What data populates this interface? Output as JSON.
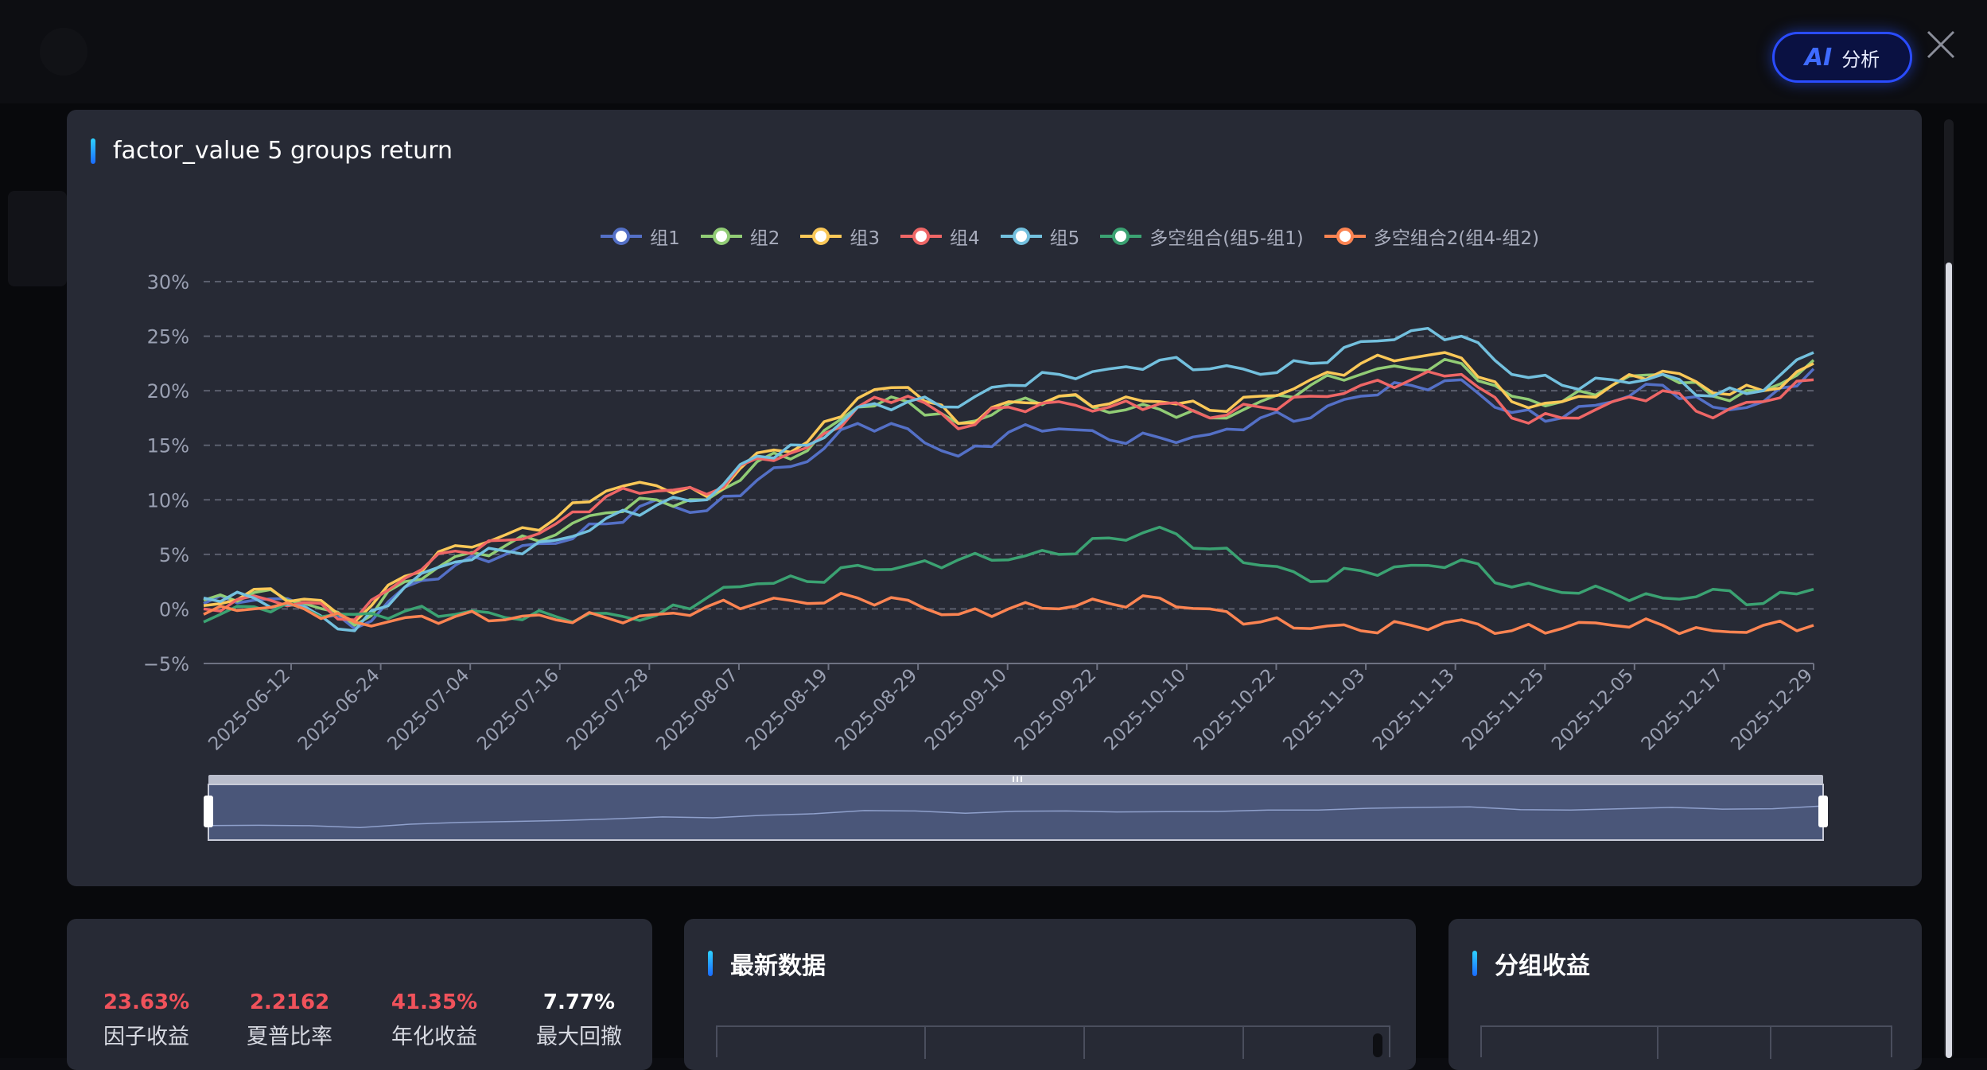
{
  "ai_button": {
    "label": "分析",
    "mark": "AI"
  },
  "main_panel": {
    "title": "factor_value 5 groups return"
  },
  "chart_data": {
    "type": "line",
    "title": "factor_value 5 groups return",
    "xlabel": "",
    "ylabel": "",
    "ylim": [
      -5,
      30
    ],
    "y_unit": "%",
    "y_ticks": [
      "30%",
      "25%",
      "20%",
      "15%",
      "10%",
      "5%",
      "0%",
      "−5%"
    ],
    "x_tick_labels": [
      "2025-06-12",
      "2025-06-24",
      "2025-07-04",
      "2025-07-16",
      "2025-07-28",
      "2025-08-07",
      "2025-08-19",
      "2025-08-29",
      "2025-09-10",
      "2025-09-22",
      "2025-10-10",
      "2025-10-22",
      "2025-11-03",
      "2025-11-13",
      "2025-11-25",
      "2025-12-05",
      "2025-12-17",
      "2025-12-29"
    ],
    "grid": "horizontal-dashed",
    "legend_position": "top-center",
    "x_points": [
      0,
      6,
      12,
      18,
      24,
      30,
      36,
      42,
      48,
      54,
      60,
      66,
      72,
      78,
      84,
      90,
      96,
      102,
      108,
      114,
      120,
      126,
      132,
      138,
      144,
      150,
      156,
      162,
      168,
      174,
      180,
      186,
      192
    ],
    "series": [
      {
        "name": "组1",
        "color": "#5470c6",
        "values": [
          0.5,
          0.8,
          0.3,
          -1.8,
          2.0,
          4.0,
          5.0,
          6.0,
          7.8,
          10.0,
          9.0,
          11.8,
          13.5,
          17.0,
          16.5,
          14.0,
          16.2,
          16.5,
          15.5,
          15.7,
          16.0,
          17.5,
          17.5,
          19.5,
          20.5,
          21.0,
          18.0,
          17.5,
          19.0,
          20.5,
          18.5,
          19.0,
          22.0
        ]
      },
      {
        "name": "组2",
        "color": "#91cc75",
        "values": [
          0.8,
          1.5,
          0.5,
          -1.5,
          2.5,
          4.8,
          5.8,
          6.8,
          8.8,
          10.0,
          10.0,
          13.5,
          14.5,
          18.5,
          19.0,
          17.0,
          18.8,
          19.5,
          18.0,
          18.3,
          17.5,
          19.0,
          20.5,
          21.5,
          22.0,
          22.5,
          19.5,
          19.0,
          20.5,
          21.5,
          19.5,
          20.0,
          22.8
        ]
      },
      {
        "name": "组3",
        "color": "#fac858",
        "values": [
          0.3,
          1.8,
          0.9,
          -1.2,
          3.0,
          5.8,
          6.8,
          8.3,
          10.8,
          11.3,
          10.3,
          14.3,
          15.3,
          19.3,
          20.3,
          17.0,
          19.0,
          19.5,
          18.8,
          19.0,
          18.2,
          19.5,
          21.0,
          22.5,
          23.0,
          23.0,
          19.0,
          19.0,
          20.5,
          21.8,
          19.8,
          20.0,
          22.5
        ]
      },
      {
        "name": "组4",
        "color": "#ee6666",
        "values": [
          0.0,
          1.2,
          0.6,
          -1.0,
          2.8,
          5.3,
          6.3,
          7.8,
          10.3,
          10.8,
          10.5,
          13.8,
          14.8,
          18.5,
          19.5,
          16.5,
          18.5,
          19.0,
          18.5,
          18.8,
          17.5,
          18.5,
          19.5,
          20.5,
          21.0,
          21.5,
          17.5,
          17.5,
          19.0,
          20.0,
          17.5,
          19.0,
          21.0
        ]
      },
      {
        "name": "组5",
        "color": "#73c0de",
        "values": [
          1.0,
          1.0,
          0.2,
          -2.0,
          2.0,
          4.3,
          5.3,
          6.3,
          8.3,
          9.5,
          10.0,
          14.0,
          15.0,
          18.5,
          19.0,
          18.5,
          20.5,
          21.5,
          22.0,
          22.8,
          22.0,
          21.5,
          22.5,
          24.5,
          25.5,
          25.0,
          21.5,
          20.5,
          21.0,
          21.5,
          19.5,
          20.0,
          23.5
        ]
      },
      {
        "name": "多空组合(组5-组1)",
        "color": "#3ba272",
        "values": [
          -1.2,
          0.2,
          0.0,
          -0.5,
          -0.2,
          -0.5,
          -0.8,
          -0.7,
          -0.4,
          -0.6,
          1.0,
          2.3,
          2.5,
          4.0,
          4.0,
          4.5,
          4.5,
          5.0,
          6.5,
          7.5,
          5.5,
          4.0,
          2.5,
          3.5,
          4.0,
          4.5,
          2.0,
          1.5,
          1.5,
          1.0,
          1.8,
          0.5,
          1.8
        ]
      },
      {
        "name": "多空组合2(组4-组2)",
        "color": "#fc8452",
        "values": [
          -0.5,
          0.0,
          0.0,
          -1.2,
          -0.8,
          -0.7,
          -1.0,
          -1.0,
          -0.8,
          -0.5,
          0.2,
          0.5,
          0.5,
          1.0,
          0.8,
          -0.5,
          0.0,
          0.0,
          0.5,
          1.0,
          0.0,
          -1.2,
          -1.8,
          -2.0,
          -1.5,
          -1.0,
          -2.0,
          -1.8,
          -1.5,
          -1.5,
          -2.0,
          -1.5,
          -1.5
        ]
      }
    ]
  },
  "stats": [
    {
      "value": "23.63%",
      "label": "因子收益",
      "color": "#f0525b"
    },
    {
      "value": "2.2162",
      "label": "夏普比率",
      "color": "#f0525b"
    },
    {
      "value": "41.35%",
      "label": "年化收益",
      "color": "#f0525b"
    },
    {
      "value": "7.77%",
      "label": "最大回撤",
      "color": "#ffffff"
    }
  ],
  "latest_panel": {
    "title": "最新数据"
  },
  "group_panel": {
    "title": "分组收益"
  }
}
